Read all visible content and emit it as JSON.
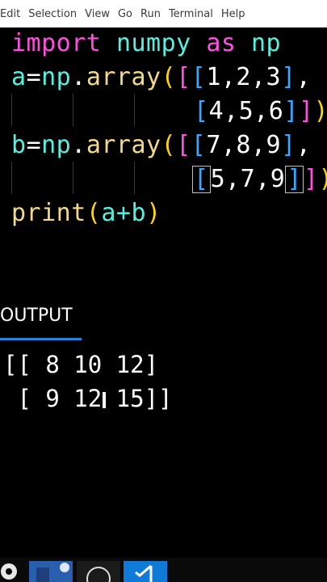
{
  "menubar": {
    "items": [
      "Edit",
      "Selection",
      "View",
      "Go",
      "Run",
      "Terminal",
      "Help"
    ]
  },
  "editor": {
    "line1": {
      "kw": "import",
      "mod": "numpy",
      "as": "as",
      "alias": "np"
    },
    "line2": {
      "var": "a",
      "eq": "=",
      "np": "np",
      "dot": ".",
      "fn": "array",
      "open1": "(",
      "open2": "[",
      "open3": "[",
      "nums": "1,2,3",
      "close3": "]",
      "comma": ","
    },
    "line3": {
      "open3": "[",
      "nums": "4,5,6",
      "close3": "]",
      "close2": "]",
      "close1": ")"
    },
    "line4": {
      "var": "b",
      "eq": "=",
      "np": "np",
      "dot": ".",
      "fn": "array",
      "open1": "(",
      "open2": "[",
      "open3": "[",
      "nums": "7,8,9",
      "close3": "]",
      "comma": ","
    },
    "line5": {
      "open3": "[",
      "nums": "5,7,9",
      "close3": "]",
      "close2": "]",
      "close1": ")"
    },
    "line6": {
      "fn": "print",
      "open": "(",
      "expr": "a+b",
      "close": ")"
    }
  },
  "panel": {
    "title": "OUTPUT",
    "lines": [
      "[[ 8 10 12]",
      " [ 9 12 15]]"
    ]
  },
  "taskbar": {
    "icons": [
      "gear-icon",
      "file-explorer-icon",
      "obs-icon",
      "vscode-icon"
    ]
  }
}
